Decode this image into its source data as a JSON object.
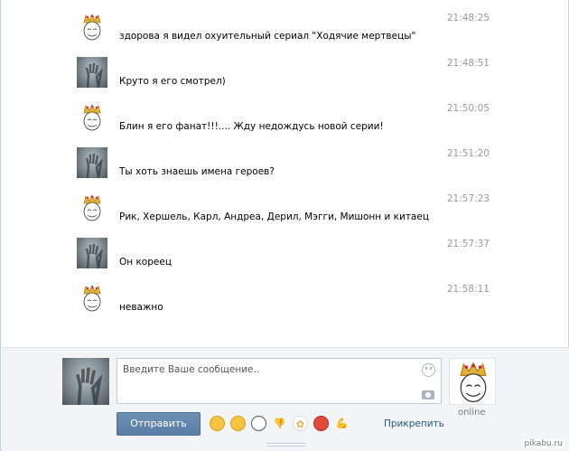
{
  "messages": [
    {
      "sender": "troll",
      "text": "здорова я видел охуительный сериал \"Ходячие мертвецы\"",
      "time": "21:48:25"
    },
    {
      "sender": "hand",
      "text": "Круто я его смотрел)",
      "time": "21:48:51"
    },
    {
      "sender": "troll",
      "text": "Блин я его фанат!!!.... Жду недождусь новой серии!",
      "time": "21:50:05"
    },
    {
      "sender": "hand",
      "text": "Ты хоть знаешь имена героев?",
      "time": "21:51:20"
    },
    {
      "sender": "troll",
      "text": "Рик, Хершель, Карл, Андреа, Дерил, Мэгги, Мишонн и китаец",
      "time": "21:57:23"
    },
    {
      "sender": "hand",
      "text": "Он кореец",
      "time": "21:57:37"
    },
    {
      "sender": "troll",
      "text": "неважно",
      "time": "21:58:11"
    }
  ],
  "composer": {
    "placeholder": "Введите Ваше сообщение..",
    "send_label": "Отправить",
    "attach_label": "Прикрепить",
    "partner_status": "online",
    "emoji": [
      "grin-emoji",
      "squint-emoji",
      "panda-emoji",
      "thumbs-down-emoji",
      "flower-emoji",
      "angry-emoji",
      "muscle-arm-emoji"
    ]
  },
  "watermark": "pikabu.ru"
}
